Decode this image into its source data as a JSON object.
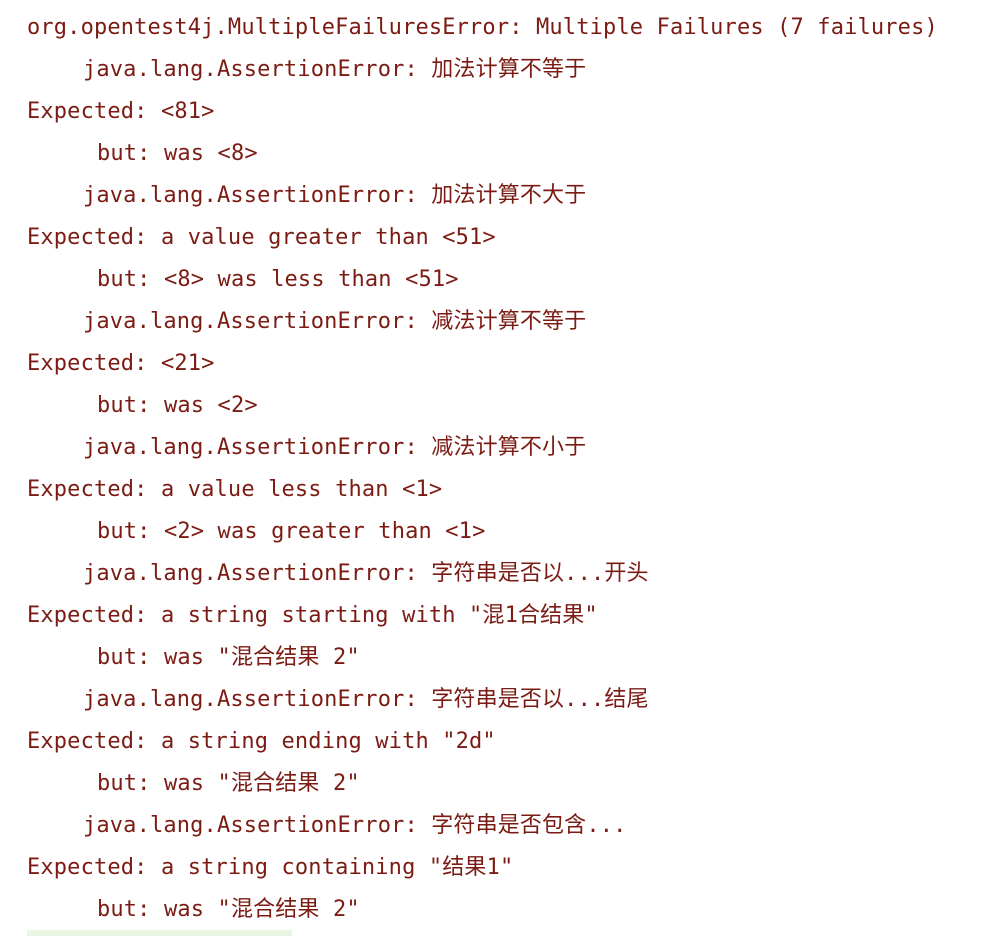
{
  "console": {
    "lines": [
      "org.opentest4j.MultipleFailuresError: Multiple Failures (7 failures)",
      "java.lang.AssertionError: 加法计算不等于",
      "Expected: <81>",
      "but: was <8>",
      "java.lang.AssertionError: 加法计算不大于",
      "Expected: a value greater than <51>",
      "but: <8> was less than <51>",
      "java.lang.AssertionError: 减法计算不等于",
      "Expected: <21>",
      "but: was <2>",
      "java.lang.AssertionError: 减法计算不小于",
      "Expected: a value less than <1>",
      "but: <2> was greater than <1>",
      "java.lang.AssertionError: 字符串是否以...开头",
      "Expected: a string starting with \"混1合结果\"",
      "but: was \"混合结果 2\"",
      "java.lang.AssertionError: 字符串是否以...结尾",
      "Expected: a string ending with \"2d\"",
      "but: was \"混合结果 2\"",
      "java.lang.AssertionError: 字符串是否包含...",
      "Expected: a string containing \"结果1\"",
      "but: was \"混合结果 2\""
    ]
  },
  "colors": {
    "error_text": "#7b1b13",
    "background": "#ffffff",
    "bottom_strip": "#eaf6e4"
  }
}
